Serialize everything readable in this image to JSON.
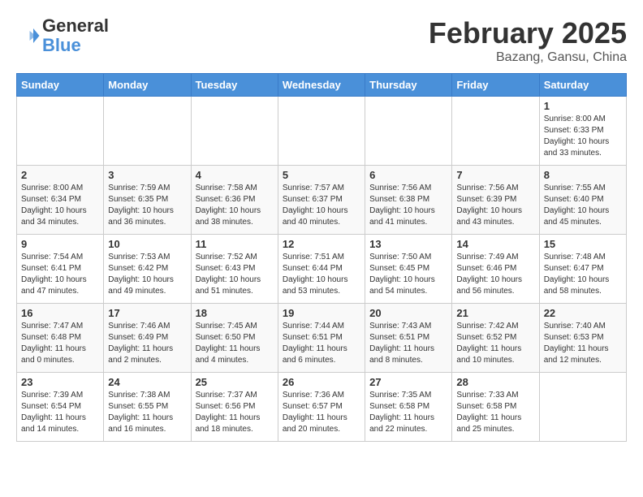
{
  "header": {
    "logo_line1": "General",
    "logo_line2": "Blue",
    "month_title": "February 2025",
    "location": "Bazang, Gansu, China"
  },
  "days_of_week": [
    "Sunday",
    "Monday",
    "Tuesday",
    "Wednesday",
    "Thursday",
    "Friday",
    "Saturday"
  ],
  "weeks": [
    {
      "days": [
        {
          "num": "",
          "info": ""
        },
        {
          "num": "",
          "info": ""
        },
        {
          "num": "",
          "info": ""
        },
        {
          "num": "",
          "info": ""
        },
        {
          "num": "",
          "info": ""
        },
        {
          "num": "",
          "info": ""
        },
        {
          "num": "1",
          "info": "Sunrise: 8:00 AM\nSunset: 6:33 PM\nDaylight: 10 hours\nand 33 minutes."
        }
      ]
    },
    {
      "days": [
        {
          "num": "2",
          "info": "Sunrise: 8:00 AM\nSunset: 6:34 PM\nDaylight: 10 hours\nand 34 minutes."
        },
        {
          "num": "3",
          "info": "Sunrise: 7:59 AM\nSunset: 6:35 PM\nDaylight: 10 hours\nand 36 minutes."
        },
        {
          "num": "4",
          "info": "Sunrise: 7:58 AM\nSunset: 6:36 PM\nDaylight: 10 hours\nand 38 minutes."
        },
        {
          "num": "5",
          "info": "Sunrise: 7:57 AM\nSunset: 6:37 PM\nDaylight: 10 hours\nand 40 minutes."
        },
        {
          "num": "6",
          "info": "Sunrise: 7:56 AM\nSunset: 6:38 PM\nDaylight: 10 hours\nand 41 minutes."
        },
        {
          "num": "7",
          "info": "Sunrise: 7:56 AM\nSunset: 6:39 PM\nDaylight: 10 hours\nand 43 minutes."
        },
        {
          "num": "8",
          "info": "Sunrise: 7:55 AM\nSunset: 6:40 PM\nDaylight: 10 hours\nand 45 minutes."
        }
      ]
    },
    {
      "days": [
        {
          "num": "9",
          "info": "Sunrise: 7:54 AM\nSunset: 6:41 PM\nDaylight: 10 hours\nand 47 minutes."
        },
        {
          "num": "10",
          "info": "Sunrise: 7:53 AM\nSunset: 6:42 PM\nDaylight: 10 hours\nand 49 minutes."
        },
        {
          "num": "11",
          "info": "Sunrise: 7:52 AM\nSunset: 6:43 PM\nDaylight: 10 hours\nand 51 minutes."
        },
        {
          "num": "12",
          "info": "Sunrise: 7:51 AM\nSunset: 6:44 PM\nDaylight: 10 hours\nand 53 minutes."
        },
        {
          "num": "13",
          "info": "Sunrise: 7:50 AM\nSunset: 6:45 PM\nDaylight: 10 hours\nand 54 minutes."
        },
        {
          "num": "14",
          "info": "Sunrise: 7:49 AM\nSunset: 6:46 PM\nDaylight: 10 hours\nand 56 minutes."
        },
        {
          "num": "15",
          "info": "Sunrise: 7:48 AM\nSunset: 6:47 PM\nDaylight: 10 hours\nand 58 minutes."
        }
      ]
    },
    {
      "days": [
        {
          "num": "16",
          "info": "Sunrise: 7:47 AM\nSunset: 6:48 PM\nDaylight: 11 hours\nand 0 minutes."
        },
        {
          "num": "17",
          "info": "Sunrise: 7:46 AM\nSunset: 6:49 PM\nDaylight: 11 hours\nand 2 minutes."
        },
        {
          "num": "18",
          "info": "Sunrise: 7:45 AM\nSunset: 6:50 PM\nDaylight: 11 hours\nand 4 minutes."
        },
        {
          "num": "19",
          "info": "Sunrise: 7:44 AM\nSunset: 6:51 PM\nDaylight: 11 hours\nand 6 minutes."
        },
        {
          "num": "20",
          "info": "Sunrise: 7:43 AM\nSunset: 6:51 PM\nDaylight: 11 hours\nand 8 minutes."
        },
        {
          "num": "21",
          "info": "Sunrise: 7:42 AM\nSunset: 6:52 PM\nDaylight: 11 hours\nand 10 minutes."
        },
        {
          "num": "22",
          "info": "Sunrise: 7:40 AM\nSunset: 6:53 PM\nDaylight: 11 hours\nand 12 minutes."
        }
      ]
    },
    {
      "days": [
        {
          "num": "23",
          "info": "Sunrise: 7:39 AM\nSunset: 6:54 PM\nDaylight: 11 hours\nand 14 minutes."
        },
        {
          "num": "24",
          "info": "Sunrise: 7:38 AM\nSunset: 6:55 PM\nDaylight: 11 hours\nand 16 minutes."
        },
        {
          "num": "25",
          "info": "Sunrise: 7:37 AM\nSunset: 6:56 PM\nDaylight: 11 hours\nand 18 minutes."
        },
        {
          "num": "26",
          "info": "Sunrise: 7:36 AM\nSunset: 6:57 PM\nDaylight: 11 hours\nand 20 minutes."
        },
        {
          "num": "27",
          "info": "Sunrise: 7:35 AM\nSunset: 6:58 PM\nDaylight: 11 hours\nand 22 minutes."
        },
        {
          "num": "28",
          "info": "Sunrise: 7:33 AM\nSunset: 6:58 PM\nDaylight: 11 hours\nand 25 minutes."
        },
        {
          "num": "",
          "info": ""
        }
      ]
    }
  ]
}
